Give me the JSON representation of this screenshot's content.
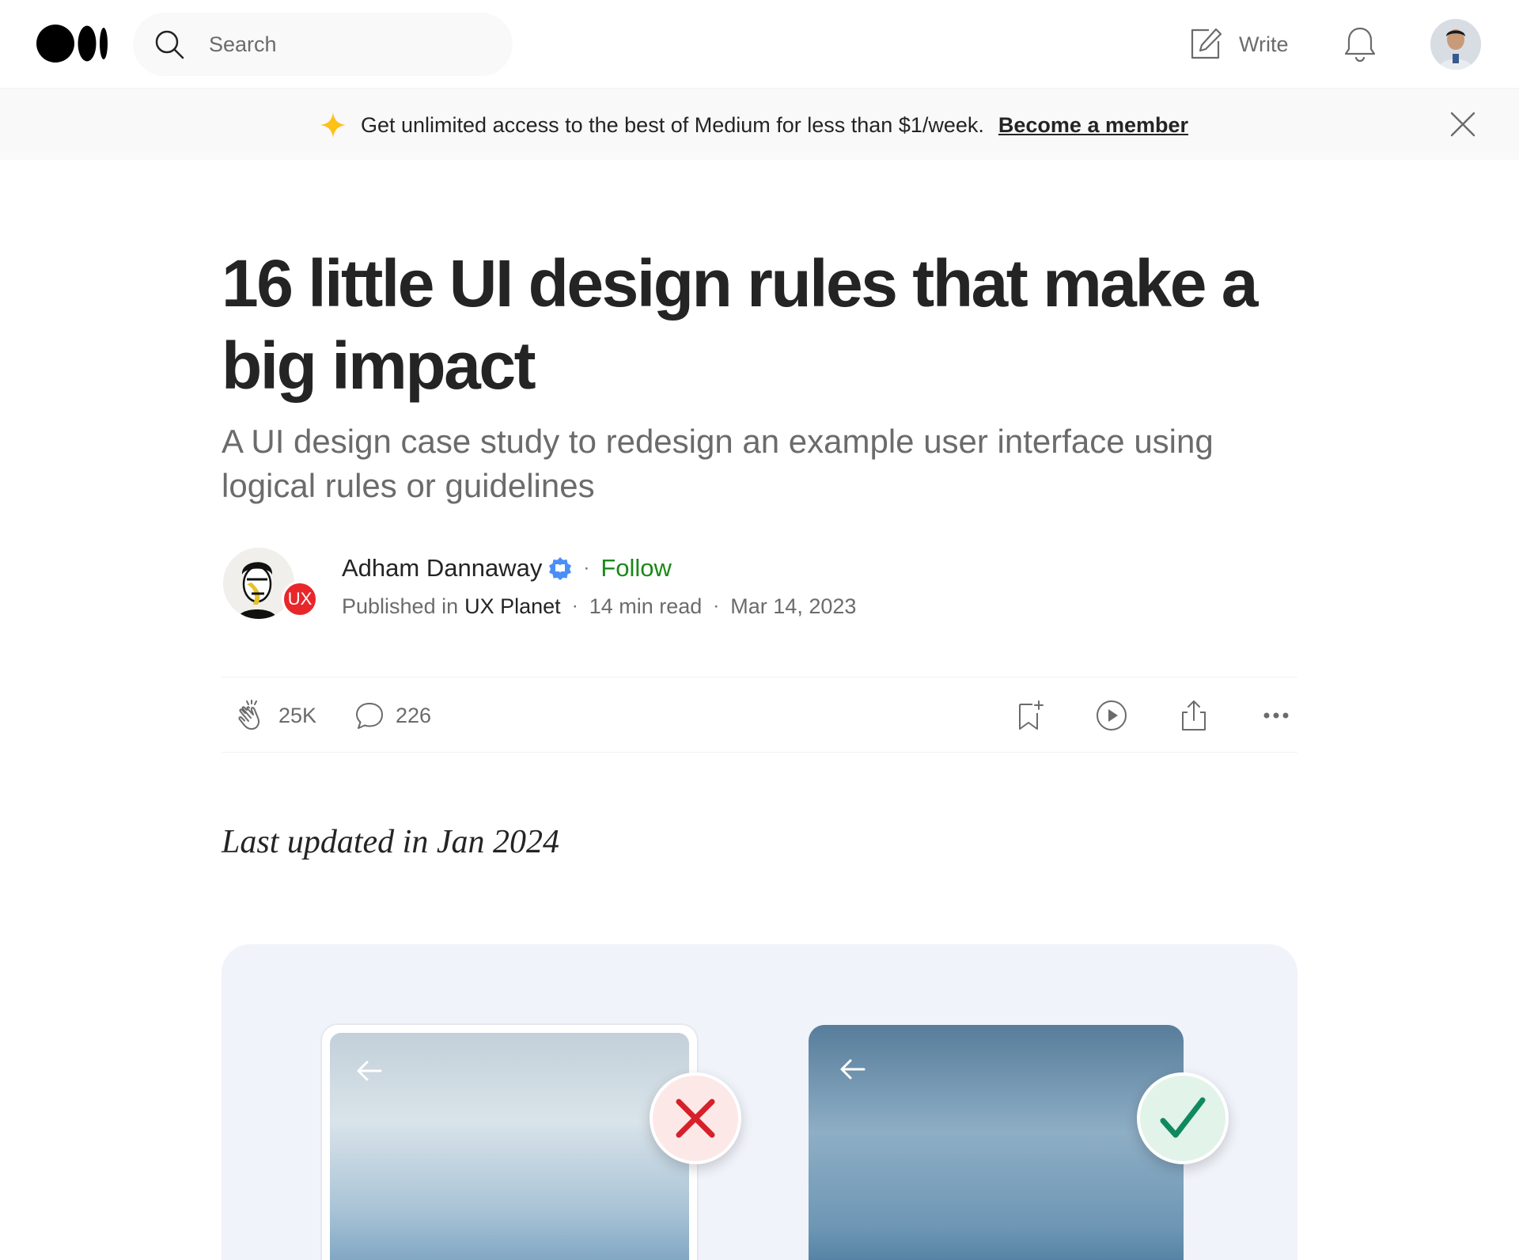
{
  "nav": {
    "search_placeholder": "Search",
    "write_label": "Write"
  },
  "banner": {
    "text": "Get unlimited access to the best of Medium for less than $1/week.",
    "link_label": "Become a member"
  },
  "article": {
    "title": "16 little UI design rules that make a big impact",
    "subtitle": "A UI design case study to redesign an example user interface using logical rules or guidelines",
    "author": "Adham Dannaway",
    "follow_label": "Follow",
    "published_in_label": "Published in",
    "publication": "UX Planet",
    "publication_badge": "UX",
    "read_time": "14 min read",
    "date": "Mar 14, 2023",
    "updated_note": "Last updated in Jan 2024"
  },
  "actions": {
    "claps": "25K",
    "responses": "226"
  },
  "colors": {
    "accent_green": "#1a8917",
    "verified_blue": "#4a8ff7",
    "banner_star": "#ffc017",
    "badge_red": "#e8272b",
    "wrong_red": "#d6202a",
    "right_green": "#0f8a5f"
  },
  "icons": [
    "medium-logo-icon",
    "search-icon",
    "write-icon",
    "bell-icon",
    "sparkle-icon",
    "close-icon",
    "verified-icon",
    "clap-icon",
    "comment-icon",
    "bookmark-icon",
    "play-icon",
    "share-icon",
    "more-icon",
    "back-arrow-icon",
    "x-icon",
    "check-icon"
  ]
}
